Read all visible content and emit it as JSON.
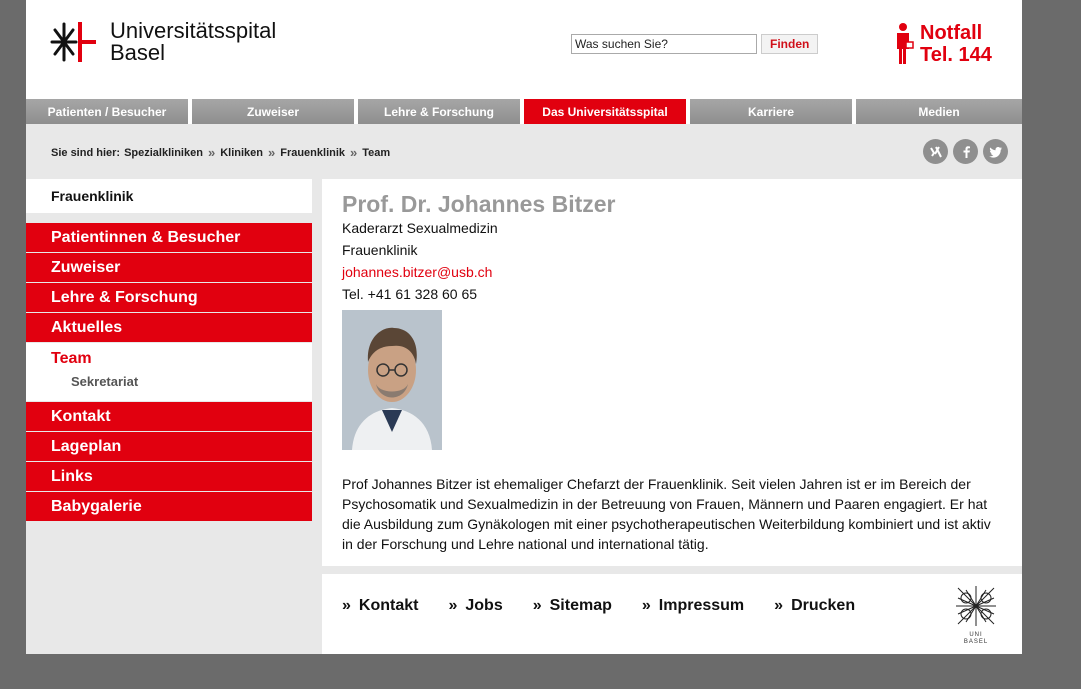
{
  "header": {
    "logo_line1": "Universitätsspital",
    "logo_line2": "Basel",
    "search_placeholder": "Was suchen Sie?",
    "search_button": "Finden",
    "emergency_line1": "Notfall",
    "emergency_line2": "Tel. 144",
    "brand_color": "#e1000f"
  },
  "topnav": {
    "items": [
      {
        "label": "Patienten / Besucher"
      },
      {
        "label": "Zuweiser"
      },
      {
        "label": "Lehre & Forschung"
      },
      {
        "label": "Das Universitätsspital"
      },
      {
        "label": "Karriere"
      },
      {
        "label": "Medien"
      }
    ],
    "active_index": 3
  },
  "breadcrumb": {
    "prefix": "Sie sind hier:",
    "items": [
      "Spezialkliniken",
      "Kliniken",
      "Frauenklinik",
      "Team"
    ],
    "separator": "»"
  },
  "social": {
    "icons": [
      {
        "name": "xing-icon",
        "glyph": "✕"
      },
      {
        "name": "facebook-icon",
        "glyph": "f"
      },
      {
        "name": "twitter-icon",
        "glyph": "🐦"
      }
    ]
  },
  "sidebar": {
    "title": "Frauenklinik",
    "items": [
      {
        "label": "Patientinnen & Besucher"
      },
      {
        "label": "Zuweiser"
      },
      {
        "label": "Lehre & Forschung"
      },
      {
        "label": "Aktuelles"
      }
    ],
    "active": {
      "label": "Team",
      "sub": "Sekretariat"
    },
    "items_after": [
      {
        "label": "Kontakt"
      },
      {
        "label": "Lageplan"
      },
      {
        "label": "Links"
      },
      {
        "label": "Babygalerie"
      }
    ]
  },
  "person": {
    "name": "Prof. Dr. Johannes Bitzer",
    "role": "Kaderarzt Sexualmedizin",
    "department": "Frauenklinik",
    "email": "johannes.bitzer@usb.ch",
    "phone": "Tel. +41 61 328 60 65",
    "bio": "Prof  Johannes Bitzer ist ehemaliger Chefarzt der Frauenklinik. Seit vielen Jahren ist er im Bereich der Psychosomatik und Sexualmedizin in der Betreuung von Frauen, Männern und Paaren engagiert. Er hat die Ausbildung zum Gynäkologen mit einer psychotherapeutischen Weiterbildung kombiniert und ist aktiv in der Forschung und Lehre national und international tätig."
  },
  "footer": {
    "links": [
      {
        "label": "Kontakt"
      },
      {
        "label": "Jobs"
      },
      {
        "label": "Sitemap"
      },
      {
        "label": "Impressum"
      },
      {
        "label": "Drucken"
      }
    ],
    "arrow": "»",
    "uni_line1": "UNI",
    "uni_line2": "BASEL"
  }
}
